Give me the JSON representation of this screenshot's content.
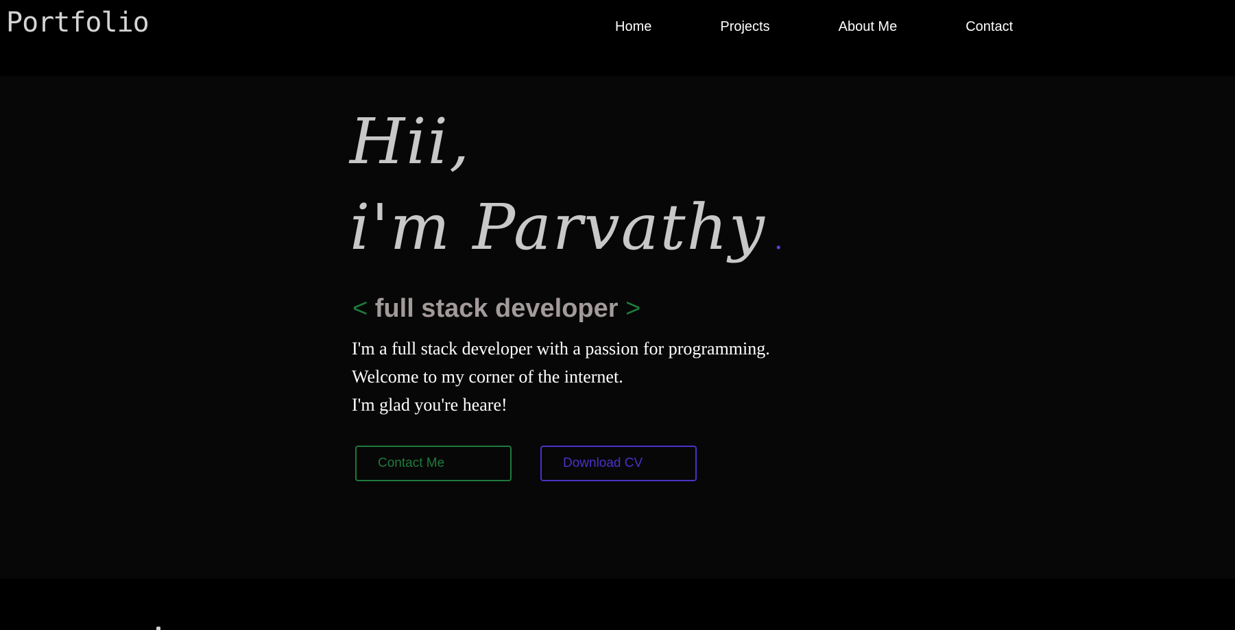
{
  "header": {
    "logo": "Portfolio",
    "nav": {
      "home": "Home",
      "projects": "Projects",
      "about": "About Me",
      "contact": "Contact"
    }
  },
  "hero": {
    "greeting": "Hii,",
    "name_line": "i'm Parvathy",
    "name_dot": ".",
    "role_open": "<",
    "role": "full stack developer",
    "role_close": ">",
    "intro": [
      "I'm a full stack developer with a passion for programming.",
      "Welcome to my corner of the internet.",
      "I'm glad you're heare!"
    ],
    "buttons": {
      "contact": "Contact Me",
      "download_cv": "Download CV"
    }
  },
  "colors": {
    "background": "#000000",
    "hero_background": "#070707",
    "accent_green": "#1f7a3c",
    "accent_purple": "#4a32c9",
    "text_light": "#ffffff",
    "text_muted": "#c8c8c8"
  }
}
